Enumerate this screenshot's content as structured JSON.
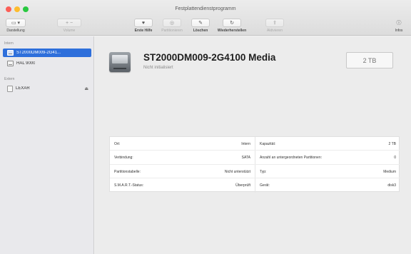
{
  "window": {
    "title": "Festplattendienstprogramm"
  },
  "toolbar": {
    "view_label": "Darstellung",
    "volume_label": "Volume",
    "first_aid_label": "Erste Hilfe",
    "partition_label": "Partitionieren",
    "erase_label": "Löschen",
    "restore_label": "Wiederherstellen",
    "unmount_label": "Aktivieren",
    "info_label": "Infos",
    "view_glyph": "▭ ▾",
    "volume_glyph": "+ −",
    "first_aid_glyph": "♥",
    "partition_glyph": "◎",
    "erase_glyph": "✎",
    "restore_glyph": "↻",
    "unmount_glyph": "⇪",
    "info_glyph": "ⓘ"
  },
  "sidebar": {
    "internal_header": "Intern",
    "external_header": "Extern",
    "internal_items": [
      {
        "label": "ST2000DM009-2G41...",
        "selected": true
      },
      {
        "label": "HAL 9000",
        "selected": false
      }
    ],
    "external_items": [
      {
        "label": "LEXAR",
        "eject": "⏏"
      }
    ]
  },
  "main": {
    "disk_name": "ST2000DM009-2G4100 Media",
    "disk_status": "Nicht initialisiert",
    "capacity_badge": "2 TB",
    "info_rows": [
      {
        "l_key": "Ort:",
        "l_val": "Intern",
        "r_key": "Kapazität:",
        "r_val": "2 TB"
      },
      {
        "l_key": "Verbindung:",
        "l_val": "SATA",
        "r_key": "Anzahl an untergeordneten Partitionen:",
        "r_val": "0"
      },
      {
        "l_key": "Partitionstabelle:",
        "l_val": "Nicht unterstützt",
        "r_key": "Typ:",
        "r_val": "Medium"
      },
      {
        "l_key": "S.M.A.R.T.-Status:",
        "l_val": "Überprüft",
        "r_key": "Gerät:",
        "r_val": "disk3"
      }
    ]
  },
  "colors": {
    "selection": "#2e6fdb",
    "traffic_red": "#fc5f57",
    "traffic_yellow": "#fdbc2e",
    "traffic_green": "#29c840"
  }
}
